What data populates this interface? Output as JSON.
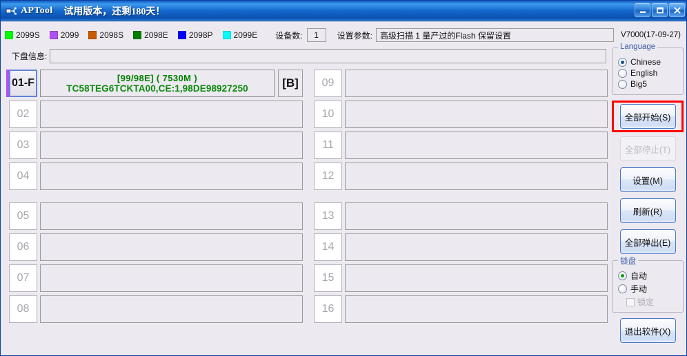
{
  "window": {
    "icon": "usb-device-icon",
    "title": "APTool",
    "subtitle": "试用版本，还剩180天！",
    "minimize_label": "minimize",
    "maximize_label": "maximize",
    "close_label": "close"
  },
  "legend": {
    "items": [
      {
        "label": "2099S",
        "color": "#00ff00"
      },
      {
        "label": "2099",
        "color": "#b050f0"
      },
      {
        "label": "2098S",
        "color": "#c85a00"
      },
      {
        "label": "2098E",
        "color": "#008000"
      },
      {
        "label": "2098P",
        "color": "#0000ff"
      },
      {
        "label": "2099E",
        "color": "#00ffff"
      }
    ]
  },
  "toolbar": {
    "device_count_label": "设备数:",
    "device_count_value": "1",
    "params_label": "设置参数:",
    "params_value": "高级扫描 1 量产过的Flash 保留设置",
    "version": "V7000(17-09-27)"
  },
  "disk_info": {
    "label": "下盘信息:",
    "value": ""
  },
  "slots": {
    "left": [
      {
        "num": "01-F",
        "active": true,
        "stripe": "#b050f0",
        "line1": "[99/98E] ( 7530M )",
        "line2": "TC58TEG6TCKTA00,CE:1,98DE98927250",
        "flag": "[B]"
      },
      {
        "num": "02",
        "active": false,
        "stripe": "",
        "line1": "",
        "line2": "",
        "flag": ""
      },
      {
        "num": "03",
        "active": false,
        "stripe": "",
        "line1": "",
        "line2": "",
        "flag": ""
      },
      {
        "num": "04",
        "active": false,
        "stripe": "",
        "line1": "",
        "line2": "",
        "flag": ""
      },
      {
        "num": "05",
        "active": false,
        "stripe": "",
        "line1": "",
        "line2": "",
        "flag": ""
      },
      {
        "num": "06",
        "active": false,
        "stripe": "",
        "line1": "",
        "line2": "",
        "flag": ""
      },
      {
        "num": "07",
        "active": false,
        "stripe": "",
        "line1": "",
        "line2": "",
        "flag": ""
      },
      {
        "num": "08",
        "active": false,
        "stripe": "",
        "line1": "",
        "line2": "",
        "flag": ""
      }
    ],
    "right": [
      {
        "num": "09",
        "active": false,
        "stripe": "",
        "line1": "",
        "line2": "",
        "flag": ""
      },
      {
        "num": "10",
        "active": false,
        "stripe": "",
        "line1": "",
        "line2": "",
        "flag": ""
      },
      {
        "num": "11",
        "active": false,
        "stripe": "",
        "line1": "",
        "line2": "",
        "flag": ""
      },
      {
        "num": "12",
        "active": false,
        "stripe": "",
        "line1": "",
        "line2": "",
        "flag": ""
      },
      {
        "num": "13",
        "active": false,
        "stripe": "",
        "line1": "",
        "line2": "",
        "flag": ""
      },
      {
        "num": "14",
        "active": false,
        "stripe": "",
        "line1": "",
        "line2": "",
        "flag": ""
      },
      {
        "num": "15",
        "active": false,
        "stripe": "",
        "line1": "",
        "line2": "",
        "flag": ""
      },
      {
        "num": "16",
        "active": false,
        "stripe": "",
        "line1": "",
        "line2": "",
        "flag": ""
      }
    ]
  },
  "language": {
    "title": "Language",
    "options": [
      {
        "label": "Chinese",
        "selected": true
      },
      {
        "label": "English",
        "selected": false
      },
      {
        "label": "Big5",
        "selected": false
      }
    ]
  },
  "lock": {
    "title": "锁盘",
    "options": [
      {
        "label": "自动",
        "selected": true
      },
      {
        "label": "手动",
        "selected": false
      }
    ],
    "checkbox_label": "锁定",
    "checkbox_checked": false,
    "checkbox_disabled": true
  },
  "buttons": {
    "start_all": "全部开始(S)",
    "stop_all": "全部停止(T)",
    "settings": "设置(M)",
    "refresh": "刷新(R)",
    "eject_all": "全部弹出(E)",
    "exit": "退出软件(X)"
  },
  "highlight": {
    "color": "#ff0000"
  }
}
